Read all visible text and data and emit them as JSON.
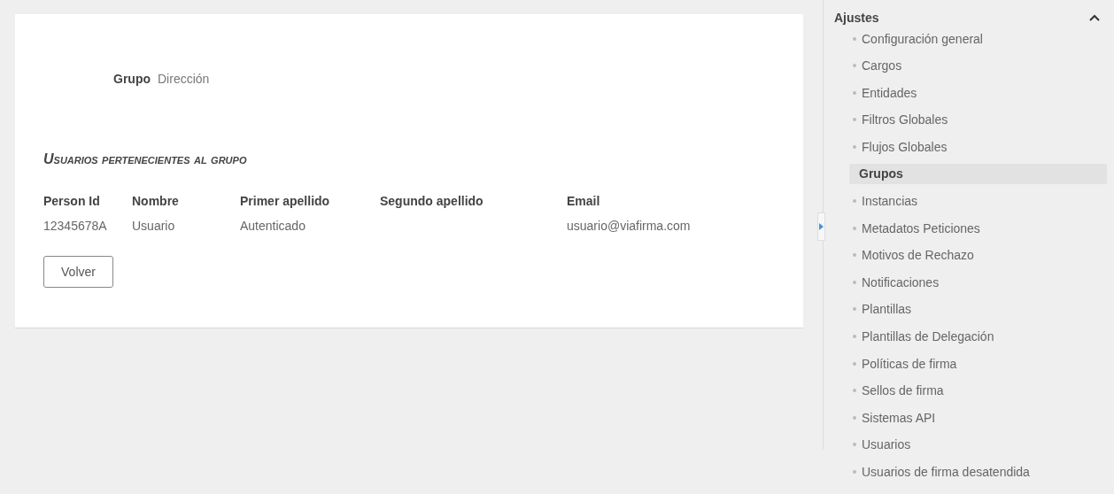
{
  "group": {
    "label": "Grupo",
    "value": "Dirección"
  },
  "section_title": "Usuarios pertenecientes al grupo",
  "table": {
    "columns": [
      "Person Id",
      "Nombre",
      "Primer apellido",
      "Segundo apellido",
      "Email"
    ],
    "rows": [
      [
        "12345678A",
        "Usuario",
        "Autenticado",
        "",
        "usuario@viafirma.com"
      ]
    ]
  },
  "buttons": [
    "Volver"
  ],
  "sidebar": {
    "title": "Ajustes",
    "expanded": true,
    "items": [
      {
        "label": "Configuración general",
        "selected": false
      },
      {
        "label": "Cargos",
        "selected": false
      },
      {
        "label": "Entidades",
        "selected": false
      },
      {
        "label": "Filtros Globales",
        "selected": false
      },
      {
        "label": "Flujos Globales",
        "selected": false
      },
      {
        "label": "Grupos",
        "selected": true
      },
      {
        "label": "Instancias",
        "selected": false
      },
      {
        "label": "Metadatos Peticiones",
        "selected": false
      },
      {
        "label": "Motivos de Rechazo",
        "selected": false
      },
      {
        "label": "Notificaciones",
        "selected": false
      },
      {
        "label": "Plantillas",
        "selected": false
      },
      {
        "label": "Plantillas de Delegación",
        "selected": false
      },
      {
        "label": "Políticas de firma",
        "selected": false
      },
      {
        "label": "Sellos de firma",
        "selected": false
      },
      {
        "label": "Sistemas API",
        "selected": false
      },
      {
        "label": "Usuarios",
        "selected": false
      },
      {
        "label": "Usuarios de firma desatendida",
        "selected": false
      }
    ]
  }
}
